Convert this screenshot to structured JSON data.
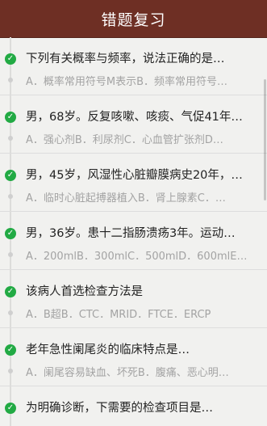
{
  "header": {
    "title": "错题复习"
  },
  "questions": [
    {
      "text": "下列有关概率与频率，说法正确的是…",
      "options": "A．概率常用符号M表示B．频率常用符号…"
    },
    {
      "text": "男，68岁。反复咳嗽、咳痰、气促41年…",
      "options": "A．强心剂B．利尿剂C．心血管扩张剂D…"
    },
    {
      "text": "男，45岁，风湿性心脏瓣膜病史20年，…",
      "options": "A．临时心脏起搏器植入B．肾上腺素C．…"
    },
    {
      "text": "男，36岁。患十二指肠溃疡3年。运动…",
      "options": "A．200mlB．300mlC．500mlD．600mlE…"
    },
    {
      "text": "该病人首选检查方法是",
      "options": "A．B超B．CTC．MRID．FTCE．ERCP"
    },
    {
      "text": "老年急性阑尾炎的临床特点是…",
      "options": "A．阑尾容易缺血、坏死B．腹痛、恶心明…"
    },
    {
      "text": "为明确诊断，下需要的检查项目是…",
      "options": ""
    }
  ],
  "colors": {
    "header_bg": "#6e2f24",
    "check": "#22aa44"
  },
  "icons": {
    "correct": "check-circle-icon"
  }
}
